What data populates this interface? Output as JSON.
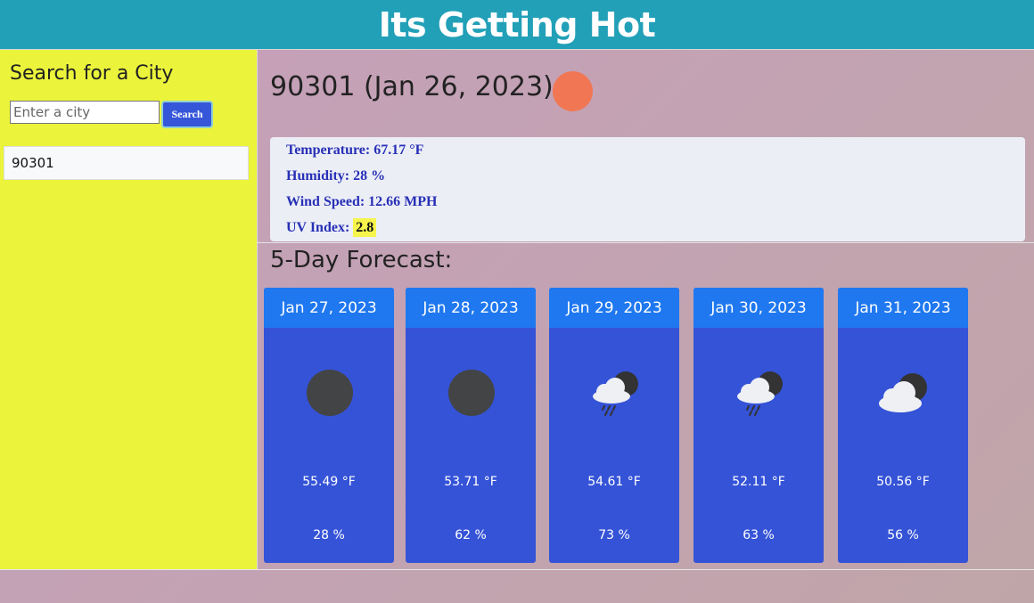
{
  "header": {
    "title": "Its Getting Hot"
  },
  "sidebar": {
    "title": "Search for a City",
    "search_placeholder": "Enter a city",
    "search_value": "",
    "search_button": "Search",
    "history": [
      "90301"
    ]
  },
  "current": {
    "city_title": "90301 (Jan 26, 2023)",
    "icon": "sun-icon",
    "icon_color": "#f17754",
    "temperature": "Temperature: 67.17 °F",
    "humidity": "Humidity: 28 %",
    "wind": "Wind Speed: 12.66 MPH",
    "uv_label": "UV Index:",
    "uv_value": "2.8"
  },
  "forecast": {
    "title": "5-Day Forecast:",
    "days": [
      {
        "date": "Jan 27, 2023",
        "icon": "dark-circle-icon",
        "temp": "55.49 °F",
        "humidity": "28 %"
      },
      {
        "date": "Jan 28, 2023",
        "icon": "dark-circle-icon",
        "temp": "53.71 °F",
        "humidity": "62 %"
      },
      {
        "date": "Jan 29, 2023",
        "icon": "rain-cloud-moon-icon",
        "temp": "54.61 °F",
        "humidity": "73 %"
      },
      {
        "date": "Jan 30, 2023",
        "icon": "rain-cloud-moon-icon",
        "temp": "52.11 °F",
        "humidity": "63 %"
      },
      {
        "date": "Jan 31, 2023",
        "icon": "cloud-moon-icon",
        "temp": "50.56 °F",
        "humidity": "56 %"
      }
    ]
  },
  "colors": {
    "header": "#22a0b8",
    "sidebar": "#ebf43b",
    "card": "#3553d7",
    "card_header": "#1f78ef",
    "stat_text": "#2730b6",
    "uv_highlight": "#f6f54b"
  }
}
